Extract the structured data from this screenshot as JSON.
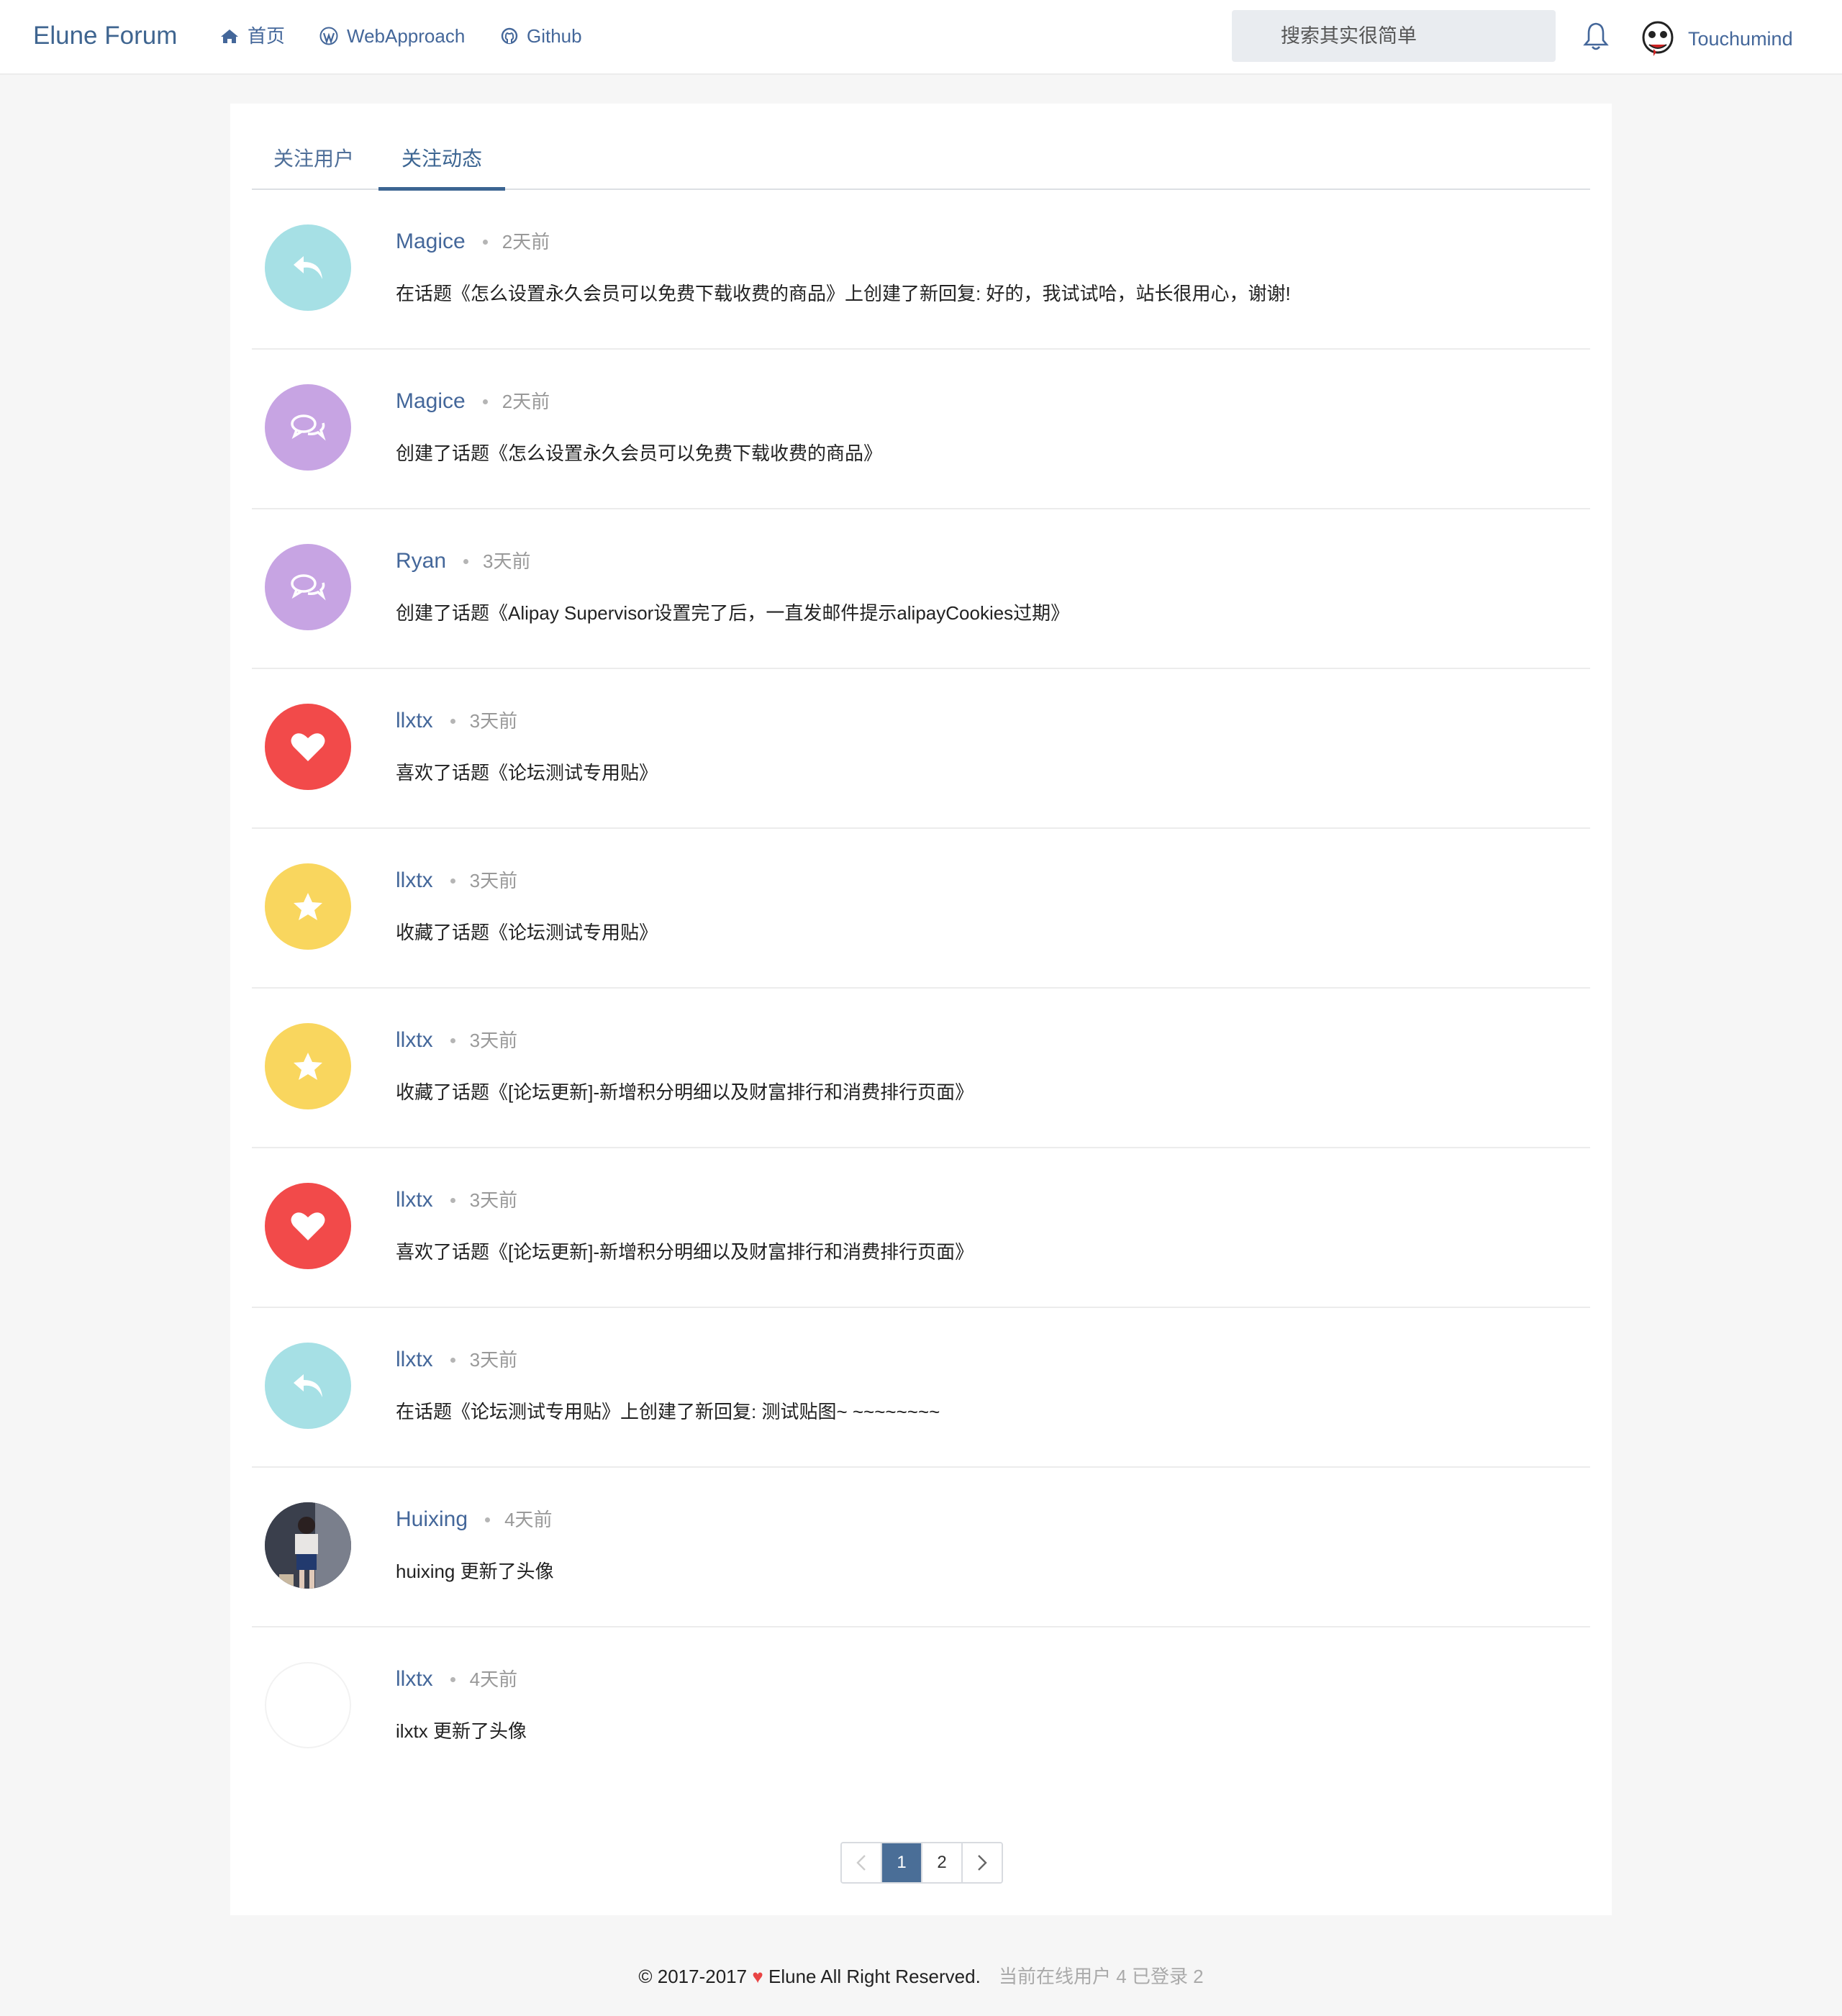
{
  "navbar": {
    "brand": "Elune Forum",
    "links": [
      {
        "label": "首页",
        "icon": "home-icon"
      },
      {
        "label": "WebApproach",
        "icon": "wordpress-icon"
      },
      {
        "label": "Github",
        "icon": "github-icon"
      }
    ],
    "search_placeholder": "搜索其实很简单",
    "user_name": "Touchumind"
  },
  "tabs": [
    {
      "label": "关注用户",
      "active": false
    },
    {
      "label": "关注动态",
      "active": true
    }
  ],
  "feed": [
    {
      "user": "Magice",
      "time": "2天前",
      "icon": "reply-icon",
      "color": "#a6e0e5",
      "text": "在话题《怎么设置永久会员可以免费下载收费的商品》上创建了新回复: 好的，我试试哈，站长很用心，谢谢!"
    },
    {
      "user": "Magice",
      "time": "2天前",
      "icon": "comments-icon",
      "color": "#c7a4e3",
      "text": "创建了话题《怎么设置永久会员可以免费下载收费的商品》"
    },
    {
      "user": "Ryan",
      "time": "3天前",
      "icon": "comments-icon",
      "color": "#c7a4e3",
      "text": "创建了话题《Alipay Supervisor设置完了后，一直发邮件提示alipayCookies过期》"
    },
    {
      "user": "llxtx",
      "time": "3天前",
      "icon": "heart-icon",
      "color": "#f24a4a",
      "text": "喜欢了话题《论坛测试专用贴》"
    },
    {
      "user": "llxtx",
      "time": "3天前",
      "icon": "star-icon",
      "color": "#f9d65e",
      "text": "收藏了话题《论坛测试专用贴》"
    },
    {
      "user": "llxtx",
      "time": "3天前",
      "icon": "star-icon",
      "color": "#f9d65e",
      "text": "收藏了话题《[论坛更新]-新增积分明细以及财富排行和消费排行页面》"
    },
    {
      "user": "llxtx",
      "time": "3天前",
      "icon": "heart-icon",
      "color": "#f24a4a",
      "text": "喜欢了话题《[论坛更新]-新增积分明细以及财富排行和消费排行页面》"
    },
    {
      "user": "llxtx",
      "time": "3天前",
      "icon": "reply-icon",
      "color": "#a6e0e5",
      "text": "在话题《论坛测试专用贴》上创建了新回复: 测试贴图~ ~~~~~~~~"
    },
    {
      "user": "Huixing",
      "time": "4天前",
      "icon": "avatar-photo",
      "color": "",
      "text": "huixing 更新了头像"
    },
    {
      "user": "llxtx",
      "time": "4天前",
      "icon": "avatar-blank",
      "color": "#ffffff",
      "text": "ilxtx 更新了头像"
    }
  ],
  "pagination": {
    "pages": [
      "1",
      "2"
    ],
    "current": "1"
  },
  "footer": {
    "copyright_prefix": "© 2017-2017",
    "heart": "♥",
    "copyright_suffix": "Elune All Right Reserved.",
    "online": "当前在线用户 4 已登录 2"
  }
}
